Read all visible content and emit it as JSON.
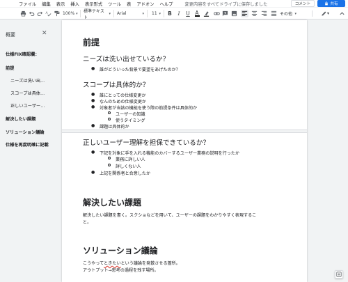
{
  "menu": {
    "items": [
      "ファイル",
      "編集",
      "表示",
      "挿入",
      "表示形式",
      "ツール",
      "表",
      "アドオン",
      "ヘルプ"
    ],
    "save_status": "変更内容をすべてドライブに保存しました",
    "comment_label": "コメント",
    "share_label": "共有"
  },
  "toolbar": {
    "zoom": "100%",
    "style": "標準テキスト",
    "font": "Arial",
    "size": "11",
    "more": "その他"
  },
  "outline": {
    "title": "概要",
    "items": [
      {
        "label": "仕様FIX確認欄：",
        "level": 1
      },
      {
        "label": "前提",
        "level": 1
      },
      {
        "label": "ニーズは洗い出せているか？",
        "level": 2
      },
      {
        "label": "スコープは具体的か？",
        "level": 2
      },
      {
        "label": "正しいユーザー理解を担保できているか？",
        "level": 2
      },
      {
        "label": "解決したい課題",
        "level": 1
      },
      {
        "label": "ソリューション議論",
        "level": 1
      },
      {
        "label": "仕様を再度明確に記載",
        "level": 1
      }
    ]
  },
  "doc": {
    "h_premise": "前提",
    "h_needs": "ニーズは洗い出せているか？",
    "needs_bullets": [
      "誰がどういった背景で要望をあげたのか？"
    ],
    "h_scope": "スコープは具体的か？",
    "scope_bullets": [
      "誰にとっての仕様変更か",
      "なんのための仕様変更か",
      "対象者が当該の機能を使う際の前提条件は具体的か"
    ],
    "scope_sub_bullets": [
      "ユーザーの知識",
      "使うタイミング"
    ],
    "scope_last_bullet": "課題は具体的か",
    "h_user": "正しいユーザー理解を担保できているか？",
    "user_bullets": [
      "下記を対象に手を入れる機能のカバーするユーザー業務の説明を行ったか"
    ],
    "user_sub_bullets": [
      "業務に詳しい人",
      "詳しくない人"
    ],
    "user_last_bullet": "上記を関係者と合意したか",
    "h_problem": "解決したい課題",
    "problem_text_1": "解決したい課題を書く。スクショなどを用いて、ユーザーの課題をわかりやすく表現するこ",
    "problem_text_2": "と。",
    "h_solution": "ソリューション議論",
    "solution_pre": "こうやって",
    "solution_misspelled": "ときたい",
    "solution_post": "という議論を発散させる箇所。",
    "solution_text_2": "アウトプット→思考の過程を残す場所。"
  },
  "colors": {
    "accent": "#1a73e8",
    "background": "#f1f3f4"
  }
}
